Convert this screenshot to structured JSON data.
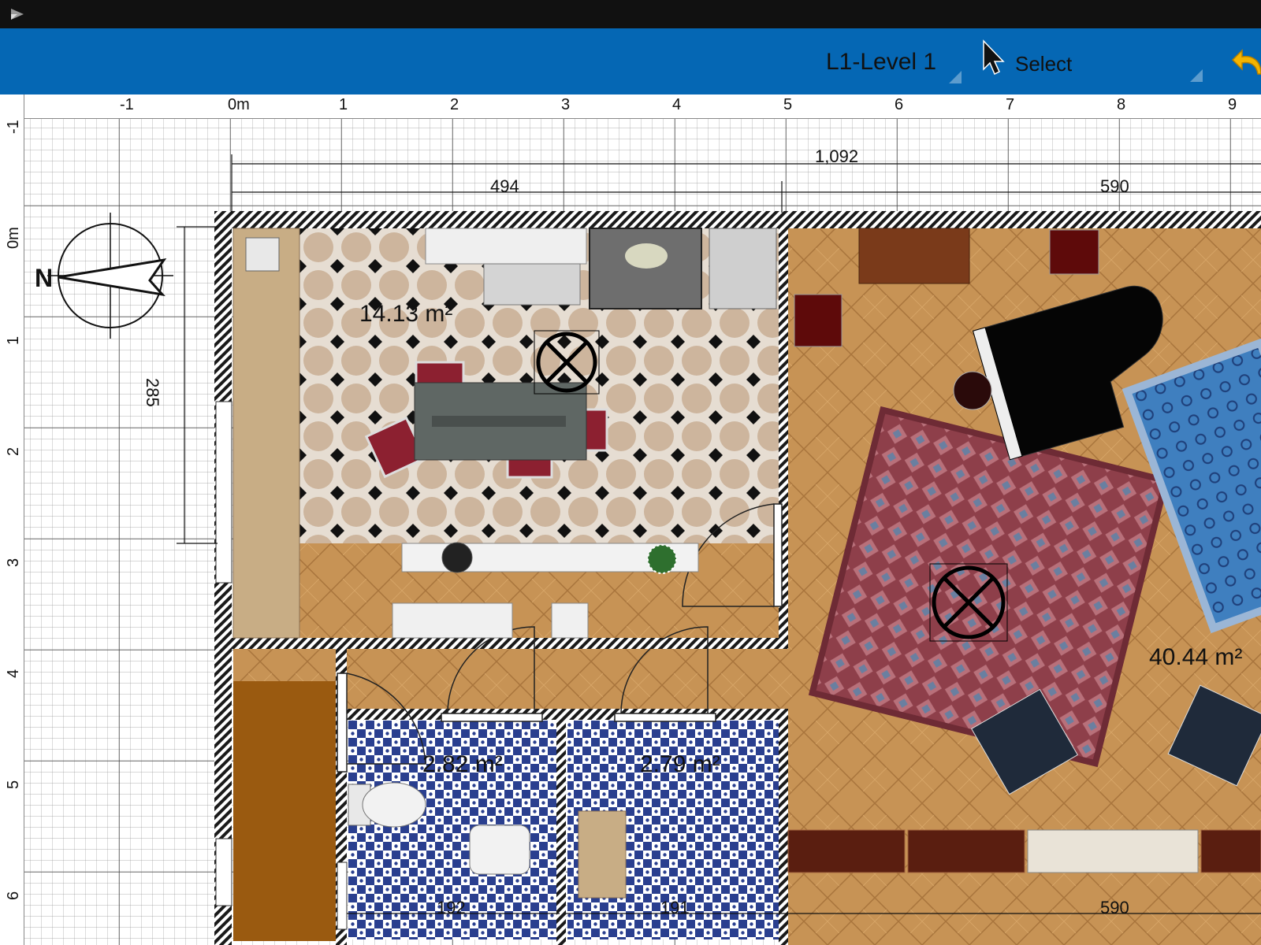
{
  "toolbar": {
    "level_label": "L1-Level 1",
    "mode_label": "Select"
  },
  "ruler": {
    "horizontal_ticks": [
      "-1",
      "0m",
      "1",
      "2",
      "3",
      "4",
      "5",
      "6",
      "7",
      "8",
      "9"
    ],
    "vertical_ticks": [
      "-1",
      "0m",
      "1",
      "2",
      "3",
      "4",
      "5",
      "6"
    ]
  },
  "dimensions": {
    "total_width": "1,092",
    "kitchen_width": "494",
    "living_width_top": "590",
    "kitchen_height": "285",
    "bath1_width": "192",
    "bath2_width": "191",
    "living_width_bottom": "590"
  },
  "rooms": {
    "kitchen_area": "14.13 m²",
    "bath1_area": "2.82 m²",
    "bath2_area": "2.79 m²",
    "living_area": "40.44 m²"
  },
  "compass": {
    "north_label": "N"
  },
  "colors": {
    "toolbar": "#0567b4",
    "statusbar": "#111111",
    "wall": "#1a1a1a",
    "parquet": "#c79355",
    "kitchen_tile": "#d8bca0",
    "bath_tile": "#2a3f8f",
    "closet": "#9a5a10"
  }
}
